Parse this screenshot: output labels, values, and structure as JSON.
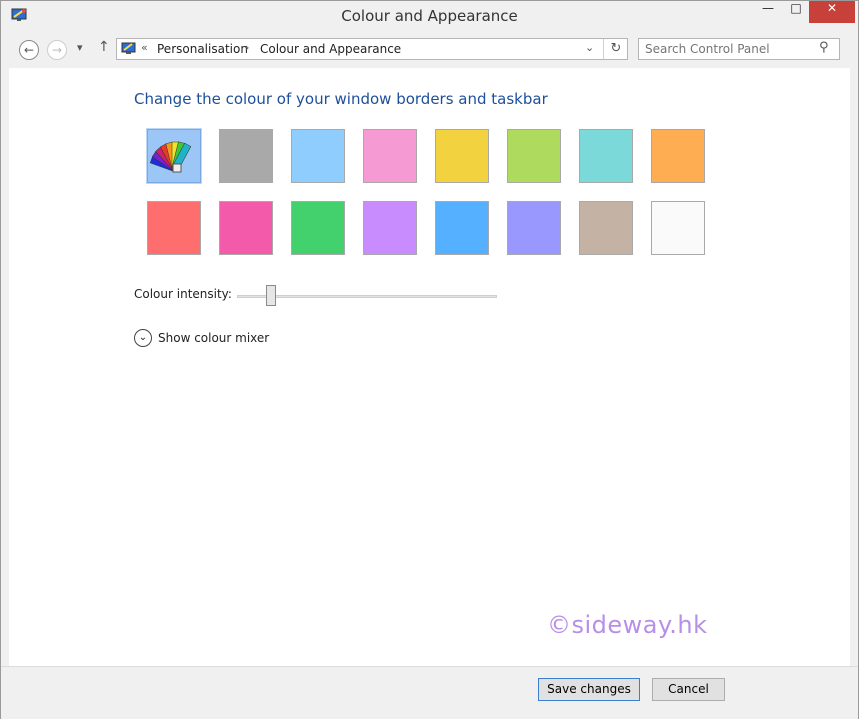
{
  "window": {
    "title": "Colour and Appearance",
    "controls": {
      "minimize": "—",
      "maximize": "□",
      "close": "✕"
    }
  },
  "nav": {
    "back_icon": "arrow-left-icon",
    "forward_icon": "arrow-right-icon",
    "recent_icon": "chevron-down-icon",
    "up_icon": "arrow-up-icon",
    "back_glyph": "←",
    "forward_glyph": "→",
    "recent_glyph": "▾",
    "up_glyph": "↑",
    "address": {
      "overflow": "«",
      "breadcrumbs": [
        "Personalisation",
        "Colour and Appearance"
      ],
      "separator": "›",
      "dropdown_glyph": "⌄",
      "refresh_glyph": "↻"
    },
    "search": {
      "placeholder": "Search Control Panel",
      "icon_glyph": "⚲"
    }
  },
  "main": {
    "heading": "Change the colour of your window borders and taskbar",
    "swatches": [
      {
        "color": "#9cc6f5",
        "selected": true,
        "icon": "colour-palette-icon"
      },
      {
        "color": "#a9a9a9"
      },
      {
        "color": "#8ecdfd"
      },
      {
        "color": "#f59ad3"
      },
      {
        "color": "#f2d33f"
      },
      {
        "color": "#aedb5e"
      },
      {
        "color": "#7bd9d9"
      },
      {
        "color": "#ffad52"
      },
      {
        "color": "#ff6e6e"
      },
      {
        "color": "#f35aaa"
      },
      {
        "color": "#43d16d"
      },
      {
        "color": "#c98cff"
      },
      {
        "color": "#55b0ff"
      },
      {
        "color": "#9898ff"
      },
      {
        "color": "#c4b3a5"
      },
      {
        "color": "#fafafa"
      }
    ],
    "intensity": {
      "label": "Colour intensity:",
      "value": 0.13
    },
    "mixer": {
      "label": "Show colour mixer",
      "icon_glyph": "⌄"
    },
    "watermark": "©sideway.hk"
  },
  "footer": {
    "save_label": "Save changes",
    "cancel_label": "Cancel"
  },
  "colors": {
    "heading": "#1e4f9b",
    "close_button": "#c7403a",
    "watermark": "#b78fe8"
  }
}
